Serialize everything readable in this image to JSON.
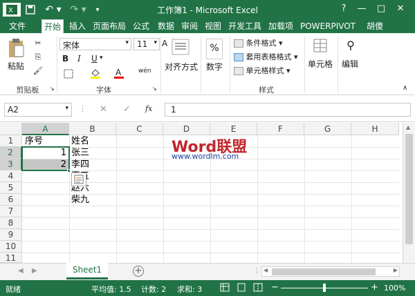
{
  "window": {
    "title": "工作簿1 - Microsoft Excel",
    "help": "?",
    "min": "—",
    "max": "□",
    "close": "✕"
  },
  "tabs": [
    {
      "label": "文件"
    },
    {
      "label": "开始"
    },
    {
      "label": "插入"
    },
    {
      "label": "页面布局"
    },
    {
      "label": "公式"
    },
    {
      "label": "数据"
    },
    {
      "label": "审阅"
    },
    {
      "label": "视图"
    },
    {
      "label": "开发工具"
    },
    {
      "label": "加载项"
    },
    {
      "label": "POWERPIVOT"
    },
    {
      "label": "胡傻"
    }
  ],
  "ribbon": {
    "clipboard": {
      "paste": "粘贴",
      "label": "剪贴板"
    },
    "font": {
      "name": "宋体",
      "size": "11",
      "grow": "A",
      "shrink": "A",
      "bold": "B",
      "italic": "I",
      "underline": "U",
      "phonetic": "wén",
      "label": "字体"
    },
    "alignment": {
      "label": "对齐方式"
    },
    "number": {
      "label": "数字",
      "icon": "%"
    },
    "styles": {
      "conditional": "条件格式",
      "table": "套用表格格式",
      "cell": "单元格样式",
      "label": "样式"
    },
    "cells": {
      "label": "单元格"
    },
    "editing": {
      "label": "编辑"
    }
  },
  "formula_bar": {
    "name_box": "A2",
    "fx": "fx",
    "value": "1"
  },
  "columns": [
    "A",
    "B",
    "C",
    "D",
    "E",
    "F",
    "G",
    "H"
  ],
  "rows": [
    "1",
    "2",
    "3",
    "4",
    "5",
    "6",
    "7",
    "8",
    "9",
    "10",
    "11"
  ],
  "cells": {
    "A1": "序号",
    "A2": "1",
    "A3": "2",
    "B1": "姓名",
    "B2": "张三",
    "B3": "李四",
    "B4": "王五",
    "B5": "赵六",
    "B6": "柴九"
  },
  "watermark": {
    "logo": "Word联盟",
    "url": "www.wordlm.com"
  },
  "sheet": {
    "tab": "Sheet1",
    "add": "+"
  },
  "status": {
    "ready": "就绪",
    "average": "平均值: 1.5",
    "count": "计数: 2",
    "sum": "求和: 3",
    "zoom": "100%"
  }
}
